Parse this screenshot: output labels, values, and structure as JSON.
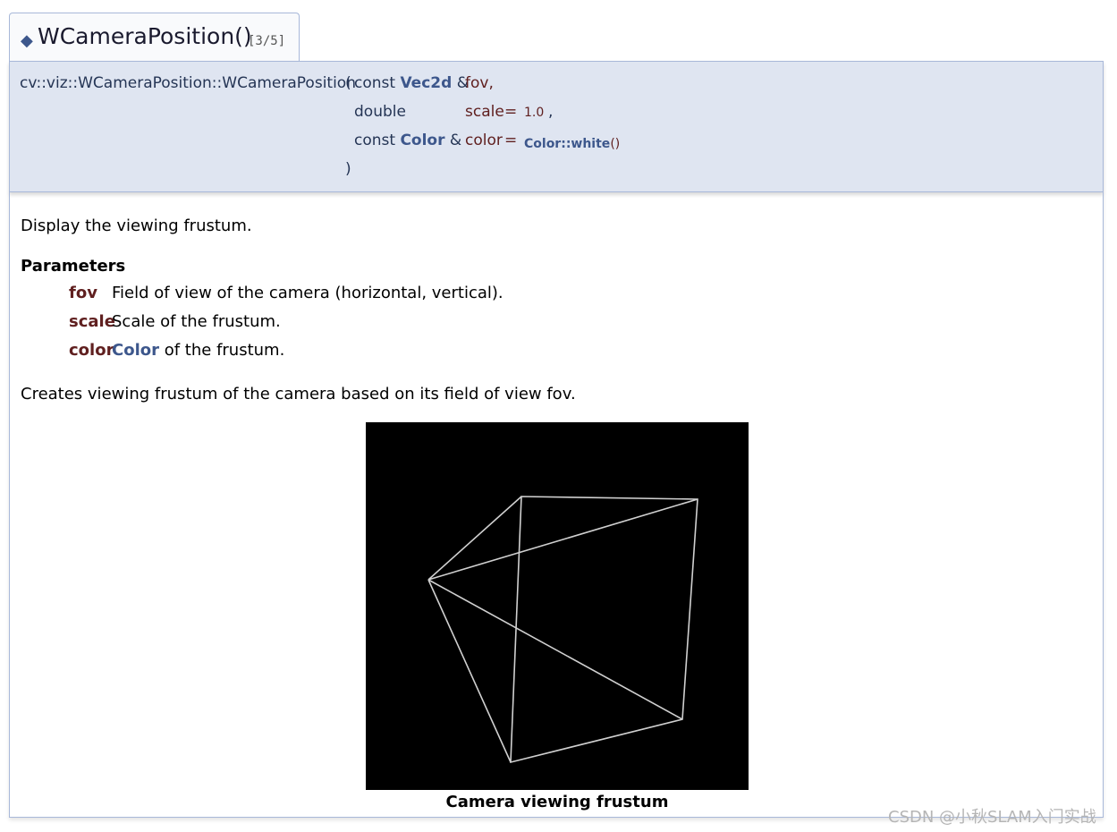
{
  "header": {
    "marker": "◆",
    "title": "WCameraPosition()",
    "overload": "[3/5]"
  },
  "prototype": {
    "qualified_name": "cv::viz::WCameraPosition::WCameraPosition",
    "open_paren": "(",
    "close_paren": ")",
    "params": [
      {
        "qualifier": "const",
        "type": "Vec2d",
        "ref": "&",
        "name": "fov,",
        "eq": "",
        "default": "",
        "tail": ""
      },
      {
        "qualifier": "double",
        "type": "",
        "ref": "",
        "name": "scale",
        "eq": "=",
        "default": "1.0",
        "tail": ","
      },
      {
        "qualifier": "const",
        "type": "Color",
        "ref": "&",
        "name": "color",
        "eq": "=",
        "default": "Color::white",
        "tail": "()"
      }
    ]
  },
  "doc": {
    "brief": "Display the viewing frustum.",
    "params_heading": "Parameters",
    "params": [
      {
        "name": "fov",
        "desc": "Field of view of the camera (horizontal, vertical)."
      },
      {
        "name": "scale",
        "desc": "Scale of the frustum."
      },
      {
        "name": "color",
        "link": "Color",
        "desc": "of the frustum."
      }
    ],
    "details": "Creates viewing frustum of the camera based on its field of view fov.",
    "figure_caption": "Camera viewing frustum"
  },
  "watermark": "CSDN @小秋SLAM入门实战"
}
